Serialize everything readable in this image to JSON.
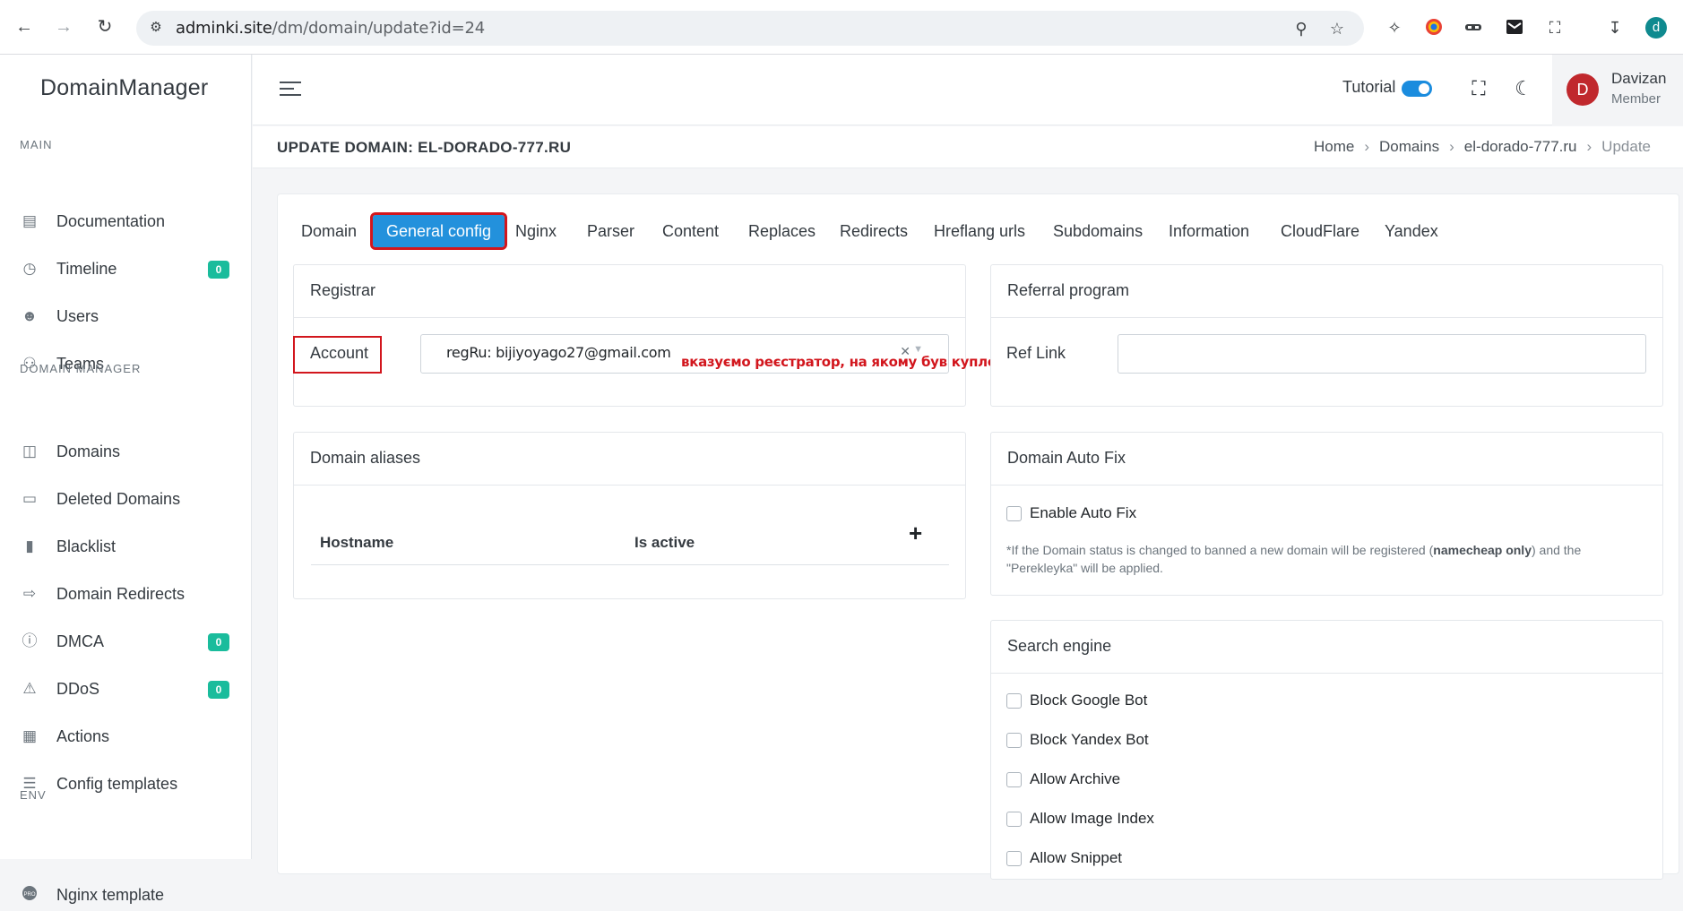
{
  "browser": {
    "url_host": "adminki.site",
    "url_path": "/dm/domain/update?id=24",
    "profile_initial": "d"
  },
  "sidebar": {
    "brand": "DomainManager",
    "sections": {
      "main": "MAIN",
      "domain_manager": "DOMAIN MANAGER",
      "env": "ENV"
    },
    "items": [
      {
        "label": "Documentation",
        "icon": "document-icon"
      },
      {
        "label": "Timeline",
        "icon": "clock-icon",
        "badge": "0"
      },
      {
        "label": "Users",
        "icon": "user-icon"
      },
      {
        "label": "Teams",
        "icon": "team-icon"
      },
      {
        "label": "Domains",
        "icon": "folder-icon"
      },
      {
        "label": "Deleted Domains",
        "icon": "book-icon"
      },
      {
        "label": "Blacklist",
        "icon": "book-closed-icon"
      },
      {
        "label": "Domain Redirects",
        "icon": "redirect-icon"
      },
      {
        "label": "DMCA",
        "icon": "alert-circle-icon",
        "badge": "0"
      },
      {
        "label": "DDoS",
        "icon": "warning-icon",
        "badge": "0"
      },
      {
        "label": "Actions",
        "icon": "grid-icon"
      },
      {
        "label": "Config templates",
        "icon": "list-settings-icon"
      },
      {
        "label": "Nginx template",
        "icon": "pro-icon"
      }
    ]
  },
  "header": {
    "tutorial_label": "Tutorial",
    "tutorial_on": true,
    "user_name": "Davizan",
    "user_role": "Member",
    "user_initial": "D"
  },
  "page": {
    "title": "UPDATE DOMAIN: EL-DORADO-777.RU",
    "breadcrumbs": [
      "Home",
      "Domains",
      "el-dorado-777.ru",
      "Update"
    ]
  },
  "tabs": [
    "Domain",
    "General config",
    "Nginx",
    "Parser",
    "Content",
    "Replaces",
    "Redirects",
    "Hreflang urls",
    "Subdomains",
    "Information",
    "CloudFlare",
    "Yandex"
  ],
  "active_tab": "General config",
  "registrar": {
    "title": "Registrar",
    "account_label": "Account",
    "account_value": "regRu: bijiyoyago27@gmail.com",
    "annotation": "вказуємо реєстратор, на якому був куплений домен"
  },
  "referral": {
    "title": "Referral program",
    "ref_link_label": "Ref Link",
    "ref_link_value": ""
  },
  "aliases": {
    "title": "Domain aliases",
    "columns": [
      "Hostname",
      "Is active"
    ],
    "add_symbol": "+"
  },
  "autofix": {
    "title": "Domain Auto Fix",
    "checkbox_label": "Enable Auto Fix",
    "note_prefix": "*If the Domain status is changed to banned a new domain will be registered (",
    "note_bold": "namecheap only",
    "note_suffix": ") and the \"Perekleyka\" will be applied."
  },
  "search_engine": {
    "title": "Search engine",
    "options": [
      "Block Google Bot",
      "Block Yandex Bot",
      "Allow Archive",
      "Allow Image Index",
      "Allow Snippet"
    ]
  },
  "colors": {
    "accent": "#2391dc",
    "annotation_red": "#d2161d",
    "badge": "#1abc9c",
    "avatar": "#c0282d"
  }
}
